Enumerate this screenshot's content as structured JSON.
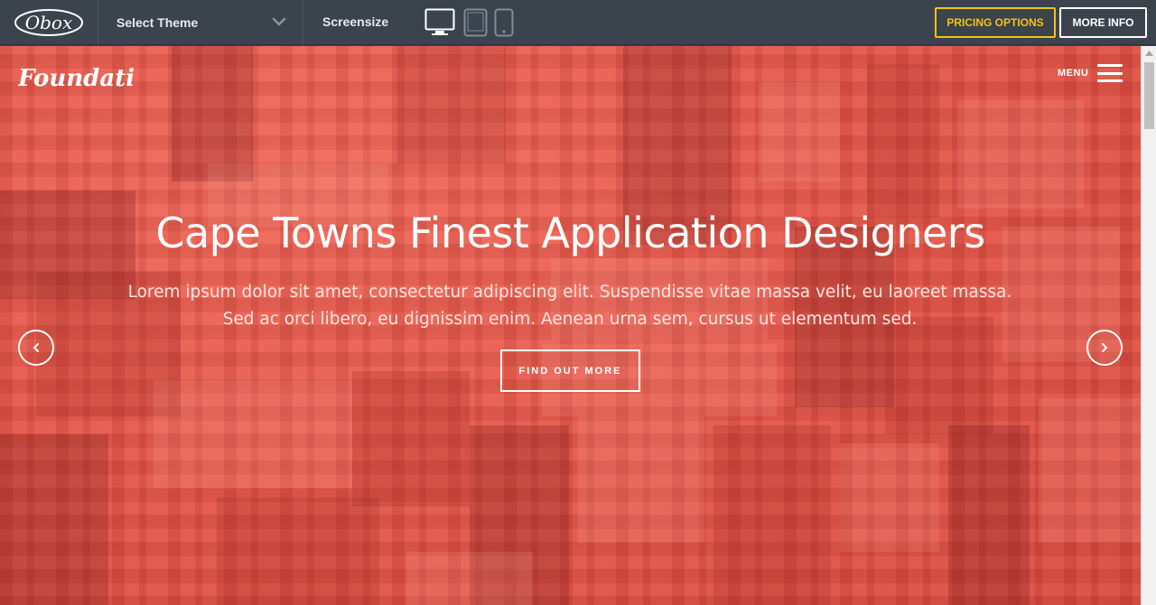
{
  "topbar": {
    "theme_select_label": "Select Theme",
    "screensize_label": "Screensize",
    "pricing_label": "PRICING OPTIONS",
    "more_info_label": "MORE INFO",
    "brand_text": "Obox"
  },
  "hero": {
    "logo_text": "Foundation",
    "menu_label": "MENU",
    "headline": "Cape Towns Finest Application Designers",
    "subtext_line1": "Lorem ipsum dolor sit amet, consectetur adipiscing elit. Suspendisse vitae massa velit, eu laoreet massa.",
    "subtext_line2": "Sed ac orci libero, eu dignissim enim. Aenean urna sem, cursus ut elementum sed.",
    "cta_label": "FIND OUT MORE"
  },
  "colors": {
    "topbar_bg": "#3b434c",
    "pricing_accent": "#f1c40f",
    "hero_overlay": "#e4584a"
  },
  "icons": {
    "theme_dropdown": "chevron-down-icon",
    "desktop": "desktop-icon",
    "tablet": "tablet-icon",
    "phone": "phone-icon",
    "menu": "hamburger-icon",
    "prev": "chevron-left-icon",
    "next": "chevron-right-icon"
  }
}
